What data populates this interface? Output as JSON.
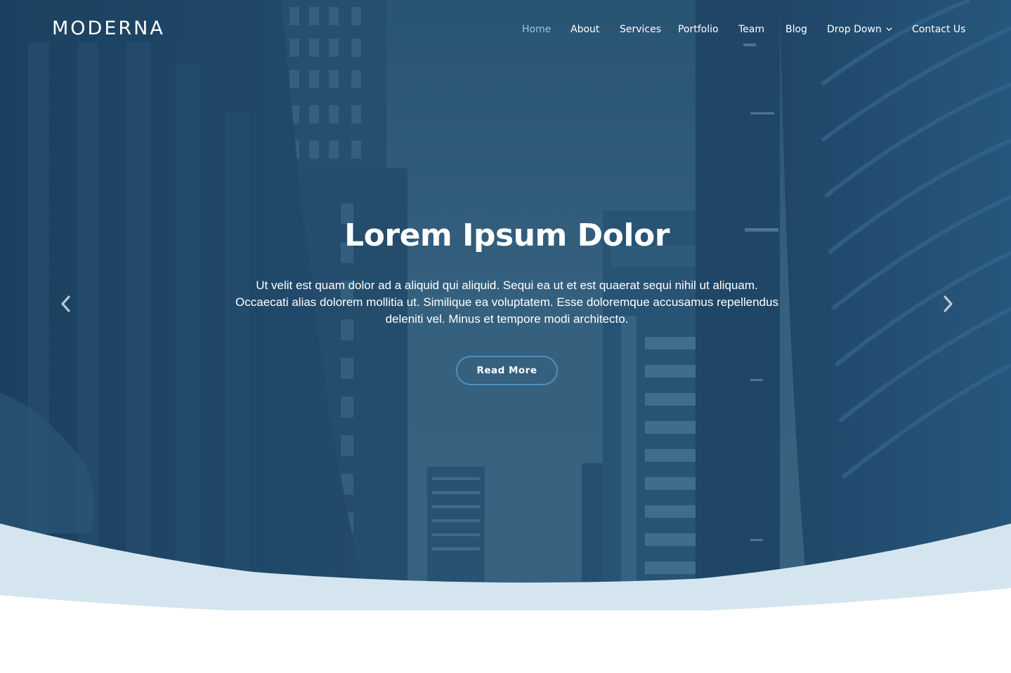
{
  "brand": {
    "logo_text": "MODERNA"
  },
  "nav": {
    "items": [
      {
        "label": "Home",
        "active": true
      },
      {
        "label": "About",
        "active": false
      },
      {
        "label": "Services",
        "active": false
      },
      {
        "label": "Portfolio",
        "active": false
      },
      {
        "label": "Team",
        "active": false
      },
      {
        "label": "Blog",
        "active": false
      },
      {
        "label": "Drop Down",
        "active": false,
        "has_dropdown": true,
        "icon": "chevron-down-icon"
      },
      {
        "label": "Contact Us",
        "active": false
      }
    ]
  },
  "hero": {
    "title": "Lorem Ipsum Dolor",
    "text": "Ut velit est quam dolor ad a aliquid qui aliquid. Sequi ea ut et est quaerat sequi nihil ut aliquam. Occaecati alias dolorem mollitia ut. Similique ea voluptatem. Esse doloremque accusamus repellendus deleniti vel. Minus et tempore modi architecto.",
    "button_label": "Read More",
    "prev_icon": "chevron-left-icon",
    "next_icon": "chevron-right-icon"
  },
  "colors": {
    "overlay": "#1e4a6e",
    "active_nav": "#8ec9e8",
    "button_border": "#4f8fbe",
    "wave_light": "#d5e5ef",
    "background": "#ffffff"
  }
}
